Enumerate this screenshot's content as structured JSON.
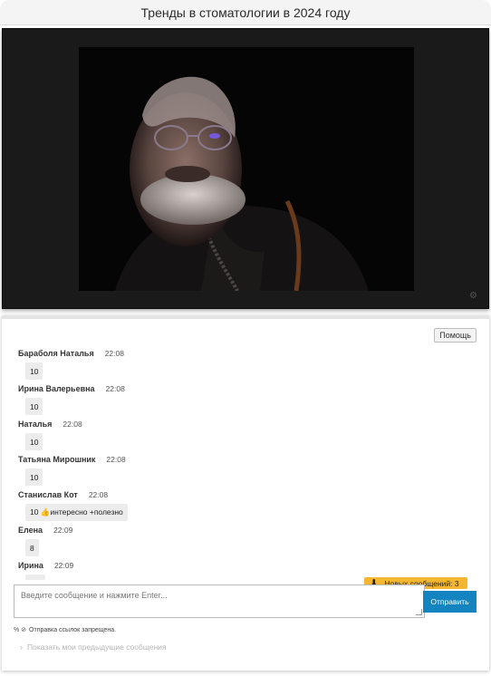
{
  "page": {
    "title": "Тренды в стоматологии в 2024 году"
  },
  "video": {
    "settings_icon": "gear-icon"
  },
  "chat": {
    "help_label": "Помощь",
    "messages": [
      {
        "author": "Бараболя Наталья",
        "time": "22:08",
        "text": "10"
      },
      {
        "author": "Ирина Валерьевна",
        "time": "22:08",
        "text": "10"
      },
      {
        "author": "Наталья",
        "time": "22:08",
        "text": "10"
      },
      {
        "author": "Татьяна Мирошник",
        "time": "22:08",
        "text": "10"
      },
      {
        "author": "Станислав Кот",
        "time": "22:08",
        "text": "10 👍интересно +полезно"
      },
      {
        "author": "Елена",
        "time": "22:09",
        "text": "8"
      },
      {
        "author": "Ирина",
        "time": "22:09",
        "text": ""
      }
    ],
    "new_messages_label": "Новых сообщений: 3",
    "input_placeholder": "Введите сообщение и нажмите Enter...",
    "send_label": "Отправить",
    "links_notice": "Отправка ссылок запрещена.",
    "show_previous_label": "Показать мои предыдущие сообщения",
    "accent_color": "#1384bf",
    "badge_color": "#f5b731"
  }
}
